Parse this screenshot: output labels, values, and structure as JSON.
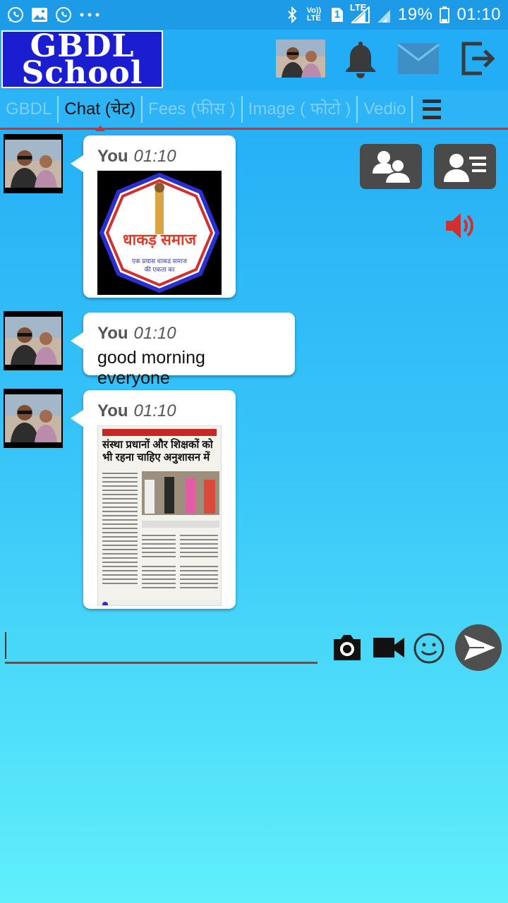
{
  "status_bar": {
    "battery": "19%",
    "time": "01:10",
    "volte": "Vo)) LTE",
    "lte": "LTE",
    "sim": "1"
  },
  "header": {
    "logo_line1": "GBDL",
    "logo_line2": "School"
  },
  "tabs": [
    {
      "label": "GBDL"
    },
    {
      "label": "Chat (चेट)"
    },
    {
      "label": "Fees (फीस )"
    },
    {
      "label": "Image ( फोटो )"
    },
    {
      "label": "Vedio"
    }
  ],
  "messages": [
    {
      "sender": "You",
      "time": "01:10",
      "type": "image",
      "image_heading": "धाकड़ समाज",
      "image_caption": "एक प्रयास धाकड समाज की एकता का"
    },
    {
      "sender": "You",
      "time": "01:10",
      "type": "text",
      "text": "good morning everyone"
    },
    {
      "sender": "You",
      "time": "01:10",
      "type": "image",
      "image_heading": "संस्था प्रधानों और शिक्षकों को भी रहना चाहिए अनुशासन में"
    }
  ],
  "colors": {
    "accent": "#d32f2f",
    "logo_bg": "#1b1ed0",
    "bg_top": "#20a8f5",
    "bg_bottom": "#5ff0fb"
  }
}
